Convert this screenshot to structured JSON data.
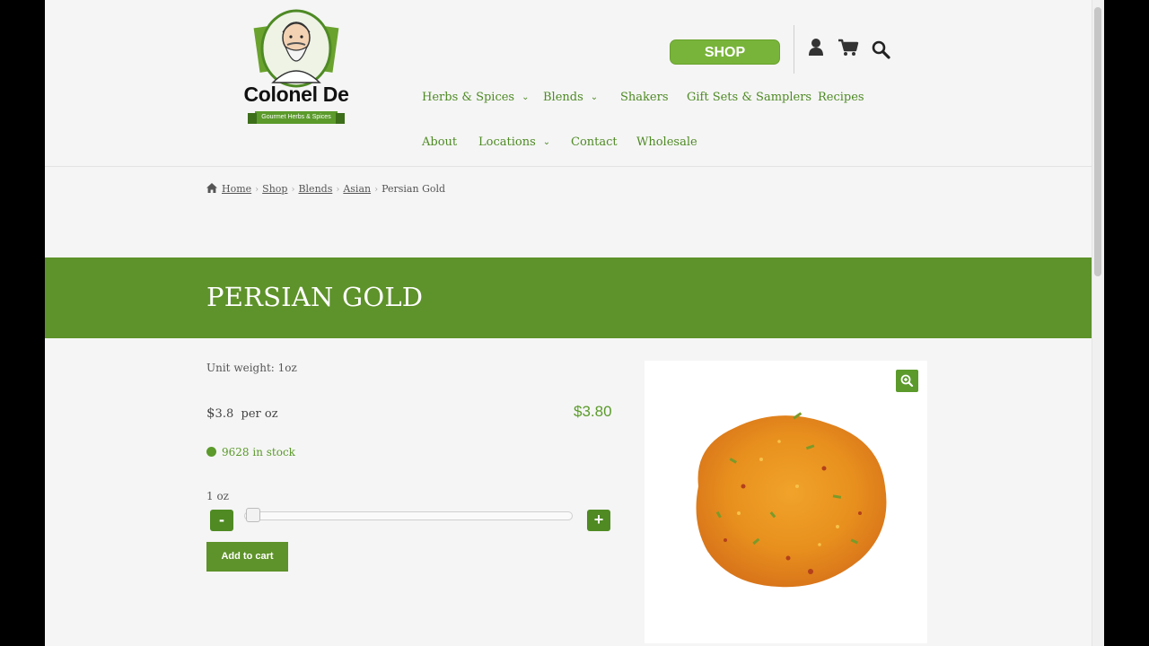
{
  "brand": {
    "name": "Colonel De",
    "tagline": "Gourmet Herbs & Spices"
  },
  "header": {
    "shop_label": "SHOP",
    "icons": [
      "user-icon",
      "cart-icon",
      "search-icon"
    ],
    "nav_row1": [
      {
        "label": "Herbs & Spices",
        "has_dropdown": true
      },
      {
        "label": "Blends",
        "has_dropdown": true
      },
      {
        "label": "Shakers",
        "has_dropdown": false
      },
      {
        "label": "Gift Sets & Samplers",
        "has_dropdown": false
      },
      {
        "label": "Recipes",
        "has_dropdown": false
      }
    ],
    "nav_row2": [
      {
        "label": "About",
        "has_dropdown": false
      },
      {
        "label": "Locations",
        "has_dropdown": true
      },
      {
        "label": "Contact",
        "has_dropdown": false
      },
      {
        "label": "Wholesale",
        "has_dropdown": false
      }
    ],
    "chevron": "⌄"
  },
  "breadcrumb": {
    "items": [
      "Home",
      "Shop",
      "Blends",
      "Asian"
    ],
    "current": "Persian Gold",
    "separator": "›"
  },
  "product": {
    "title": "PERSIAN GOLD",
    "unit_weight": "Unit weight: 1oz",
    "unit_price_currency": "$",
    "unit_price_value": "3.8",
    "unit_price_suffix": "per  oz",
    "total_price": "$3.80",
    "stock_text": "9628 in stock",
    "quantity_label": "1 oz",
    "quantity_fraction": 0.0,
    "minus_label": "-",
    "plus_label": "+",
    "add_to_cart_label": "Add to cart"
  },
  "colors": {
    "accent": "#5e922a",
    "link_green": "#4e8a24",
    "shop_button": "#78b43a",
    "spice_orange": "#e8901e"
  }
}
